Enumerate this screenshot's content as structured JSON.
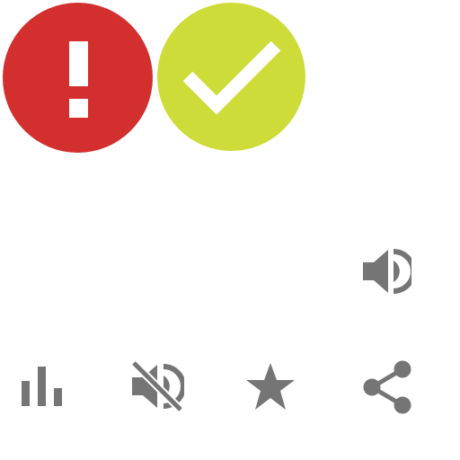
{
  "icons": {
    "error": {
      "name": "error-icon",
      "color": "#d32f2f",
      "glyph_color": "#ffffff"
    },
    "success": {
      "name": "checkmark-icon",
      "color": "#cddc39",
      "glyph_color": "#ffffff"
    },
    "volume": {
      "name": "volume-up-icon",
      "color": "#757575"
    },
    "chart": {
      "name": "bar-chart-icon",
      "color": "#757575"
    },
    "mute": {
      "name": "volume-off-icon",
      "color": "#757575"
    },
    "star": {
      "name": "star-icon",
      "color": "#757575"
    },
    "share": {
      "name": "share-icon",
      "color": "#757575"
    }
  }
}
